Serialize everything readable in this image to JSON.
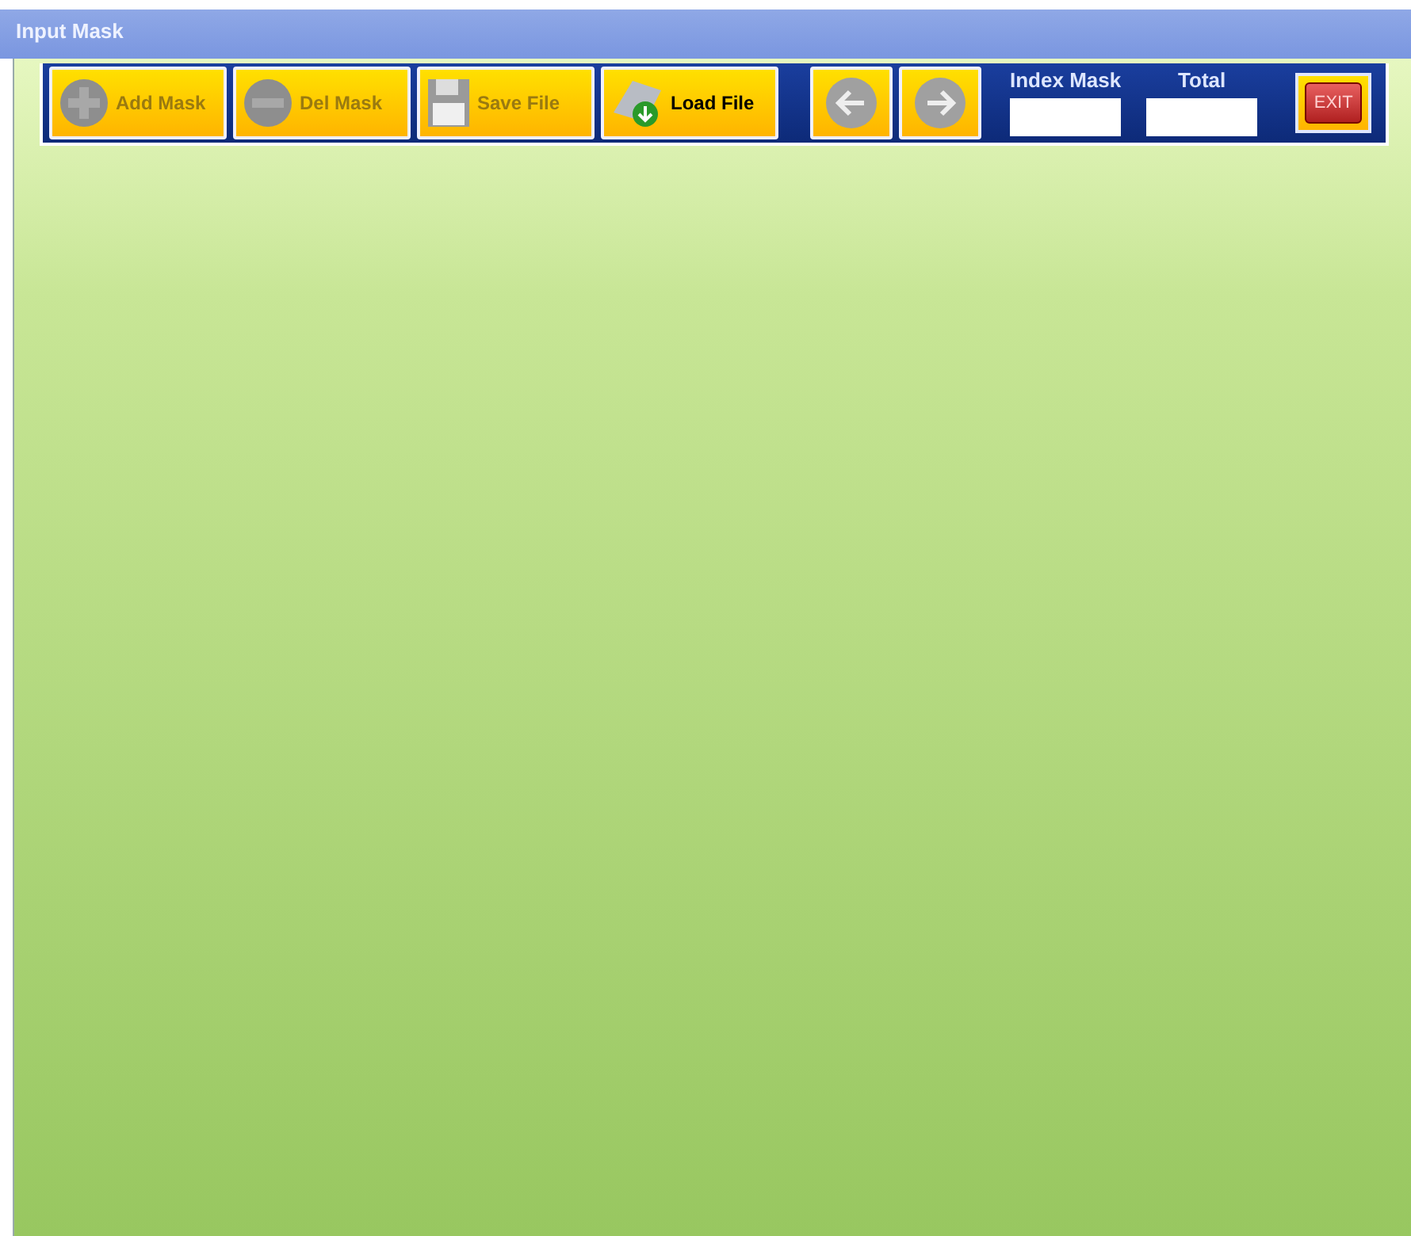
{
  "window": {
    "title": "Input Mask"
  },
  "toolbar": {
    "buttons": [
      {
        "kind": "add",
        "label": "Add Mask",
        "disabled": true
      },
      {
        "kind": "delete",
        "label": "Del Mask",
        "disabled": true
      },
      {
        "kind": "save",
        "label": "Save File",
        "disabled": true
      },
      {
        "kind": "load",
        "label": "Load File",
        "disabled": false
      }
    ],
    "nav_buttons": [
      {
        "kind": "back",
        "disabled": true
      },
      {
        "kind": "forward",
        "disabled": true
      }
    ],
    "fields": [
      {
        "label": "Index Mask"
      },
      {
        "label": "Total"
      }
    ],
    "exit_button": {
      "label": "EXIT"
    }
  }
}
